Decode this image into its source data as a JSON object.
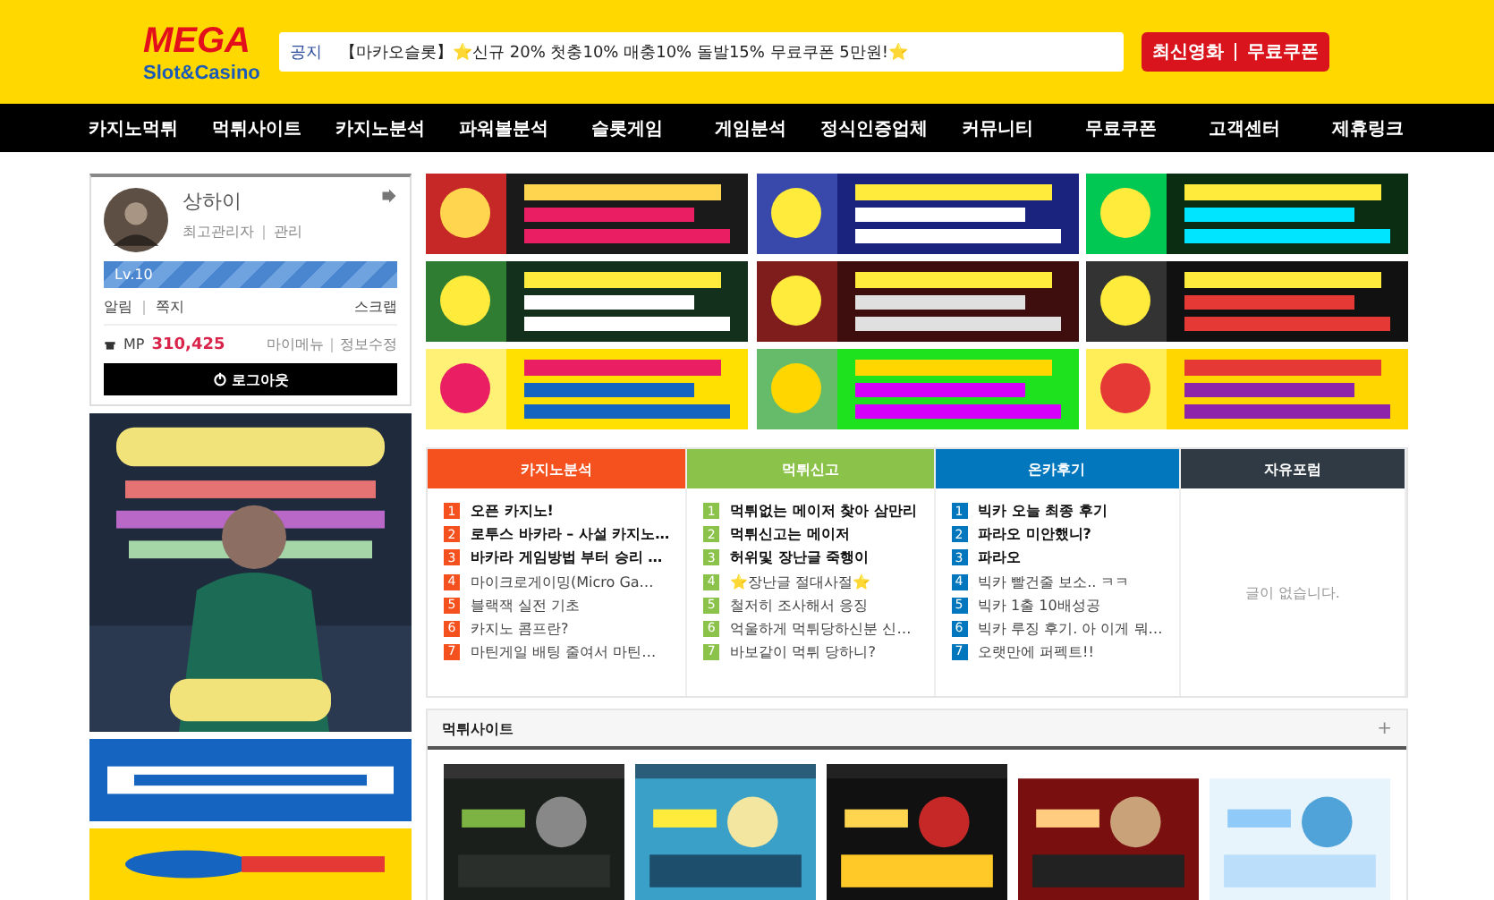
{
  "header": {
    "logo_top": "MEGA",
    "logo_bottom": "Slot&Casino",
    "notice_label": "공지",
    "notice_text": "【마카오슬롯】⭐신규 20% 첫충10% 매충10% 돌발15% 무료쿠폰 5만원!⭐",
    "links": [
      "최신영화",
      "무료쿠폰"
    ]
  },
  "nav": [
    "카지노먹튀",
    "먹튀사이트",
    "카지노분석",
    "파워볼분석",
    "슬롯게임",
    "게임분석",
    "정식인증업체",
    "커뮤니티",
    "무료쿠폰",
    "고객센터",
    "제휴링크"
  ],
  "profile": {
    "name": "상하이",
    "role": "최고관리자",
    "admin_link": "관리",
    "level_label": "Lv.10",
    "level": 1,
    "links_left": [
      "알림",
      "쪽지"
    ],
    "scrap": "스크랩",
    "points_label": "MP",
    "points": "310,425",
    "links_right": [
      "마이메뉴",
      "정보수정"
    ],
    "logout": "로그아웃"
  },
  "boards": [
    {
      "title": "카지노분석",
      "color": "#f4511e",
      "items": [
        {
          "num": "1",
          "text": "오픈 카지노!",
          "hot": true
        },
        {
          "num": "2",
          "text": "로투스 바카라 – 사설 카지노…",
          "hot": true
        },
        {
          "num": "3",
          "text": "바카라 게임방법 부터 승리 …",
          "hot": true
        },
        {
          "num": "4",
          "text": "마이크로게이밍(Micro Ga…",
          "hot": false
        },
        {
          "num": "5",
          "text": "블랙잭 실전 기초",
          "hot": false
        },
        {
          "num": "6",
          "text": "카지노 콤프란?",
          "hot": false
        },
        {
          "num": "7",
          "text": "마틴게일 배팅 줄여서 마틴…",
          "hot": false
        }
      ]
    },
    {
      "title": "먹튀신고",
      "color": "#8bc34a",
      "items": [
        {
          "num": "1",
          "text": "먹튀없는 메이저 찾아 삼만리",
          "hot": true
        },
        {
          "num": "2",
          "text": "먹튀신고는 메이저",
          "hot": true
        },
        {
          "num": "3",
          "text": "허위및 장난글 죽행이",
          "hot": true
        },
        {
          "num": "4",
          "text": "⭐장난글 절대사절⭐",
          "hot": false
        },
        {
          "num": "5",
          "text": "철저히 조사해서 응징",
          "hot": false
        },
        {
          "num": "6",
          "text": "억울하게 먹튀당하신분 신…",
          "hot": false
        },
        {
          "num": "7",
          "text": "바보같이 먹튀 당하니?",
          "hot": false
        }
      ]
    },
    {
      "title": "온카후기",
      "color": "#0277bd",
      "items": [
        {
          "num": "1",
          "text": "빅카 오늘 최종 후기",
          "hot": true
        },
        {
          "num": "2",
          "text": "파라오 미안했니?",
          "hot": true
        },
        {
          "num": "3",
          "text": "파라오",
          "hot": true
        },
        {
          "num": "4",
          "text": "빅카 빨건줄 보소.. ㅋㅋ",
          "hot": false
        },
        {
          "num": "5",
          "text": "빅카 1출 10배성공",
          "hot": false
        },
        {
          "num": "6",
          "text": "빅카 루징 후기. 아 이게 뭐…",
          "hot": false
        },
        {
          "num": "7",
          "text": "오랫만에 퍼펙트!!",
          "hot": false
        }
      ]
    },
    {
      "title": "자유포럼",
      "color": "#2f3a45",
      "empty": "글이 없습니다."
    }
  ],
  "sites": {
    "title": "먹튀사이트",
    "plus": "+"
  }
}
